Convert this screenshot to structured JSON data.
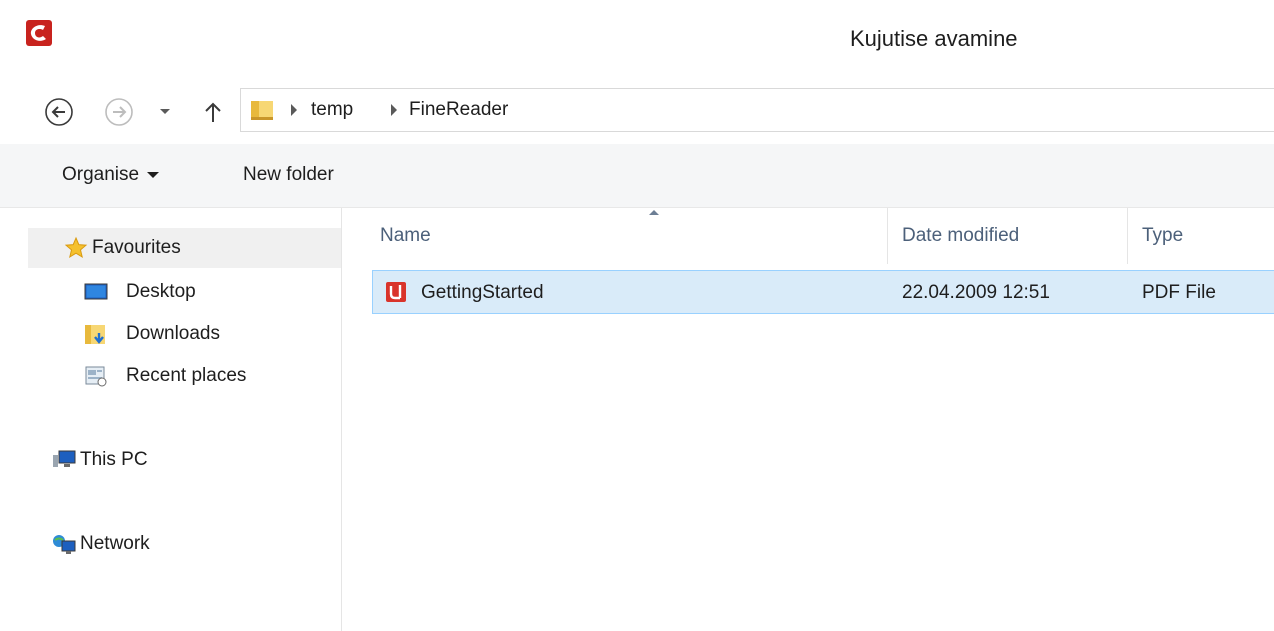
{
  "window": {
    "title": "Kujutise avamine",
    "app_icon": "abbyy-finereader-icon"
  },
  "navigation": {
    "back_icon": "back-arrow-icon",
    "forward_icon": "forward-arrow-icon",
    "recent_icon": "chevron-down-icon",
    "up_icon": "up-arrow-icon",
    "breadcrumb": [
      "temp",
      "FineReader"
    ]
  },
  "toolbar": {
    "organise_label": "Organise",
    "new_folder_label": "New folder"
  },
  "nav_pane": {
    "favourites": "Favourites",
    "items": [
      {
        "label": "Desktop",
        "icon": "desktop-icon"
      },
      {
        "label": "Downloads",
        "icon": "downloads-folder-icon"
      },
      {
        "label": "Recent places",
        "icon": "recent-places-icon"
      }
    ],
    "this_pc": "This PC",
    "network": "Network"
  },
  "file_list": {
    "columns": [
      "Name",
      "Date modified",
      "Type"
    ],
    "sort_column": "Name",
    "rows": [
      {
        "name": "GettingStarted",
        "date_modified": "22.04.2009 12:51",
        "type": "PDF File",
        "icon": "pdf-icon"
      }
    ]
  },
  "colors": {
    "accent_selection": "#d9ebf9",
    "selection_border": "#99d1ff",
    "header_text": "#4c607a",
    "pdf_red": "#d9342b"
  }
}
